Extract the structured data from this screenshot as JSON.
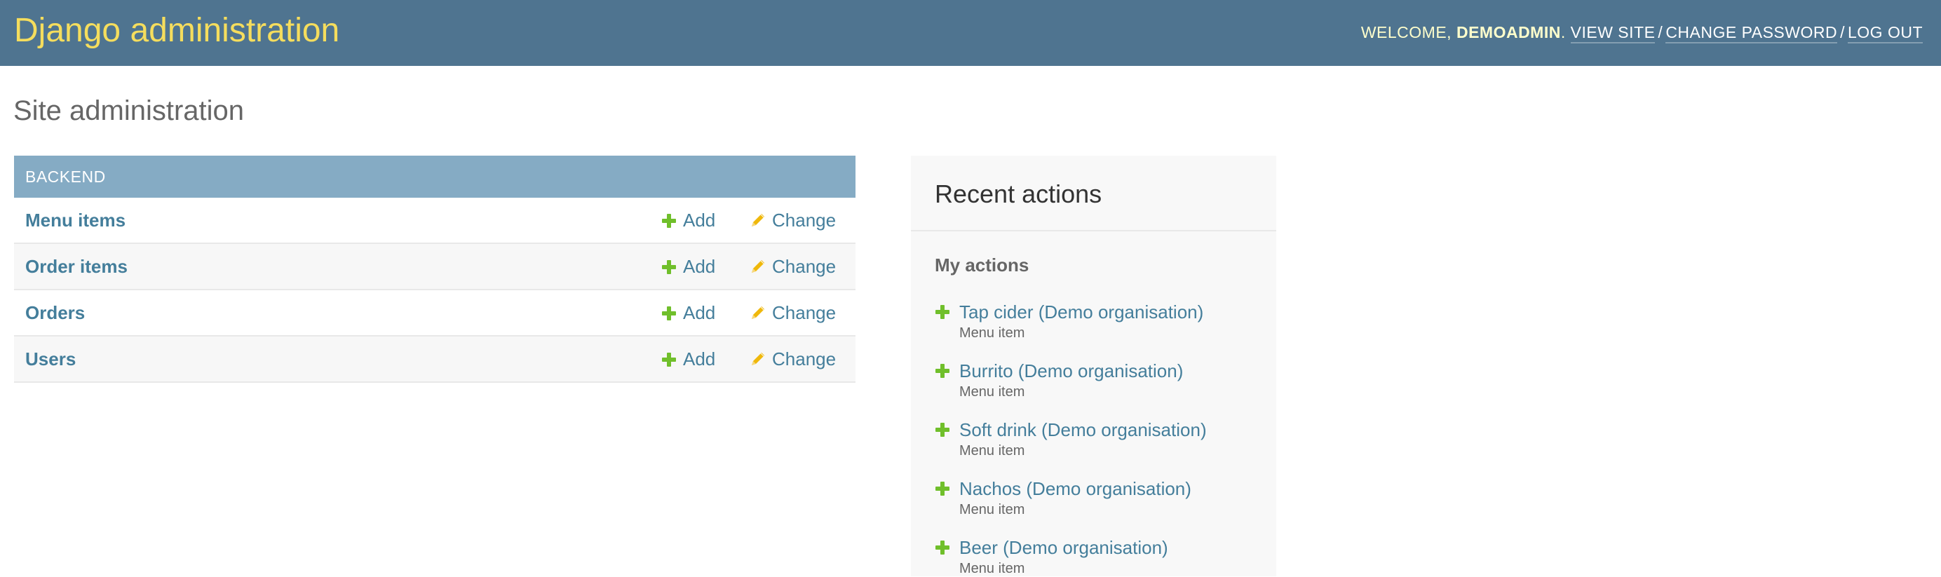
{
  "header": {
    "branding": "Django administration",
    "welcome_prefix": "Welcome, ",
    "username": "demoadmin",
    "welcome_suffix": ". ",
    "links": [
      {
        "label": "View site"
      },
      {
        "label": "Change password"
      },
      {
        "label": "Log out"
      }
    ],
    "separator": "/"
  },
  "page": {
    "title": "Site administration"
  },
  "module": {
    "caption": "Backend",
    "add_label": "Add",
    "change_label": "Change",
    "models": [
      {
        "name": "Menu items"
      },
      {
        "name": "Order items"
      },
      {
        "name": "Orders"
      },
      {
        "name": "Users"
      }
    ]
  },
  "recent_actions": {
    "title": "Recent actions",
    "subtitle": "My actions",
    "items": [
      {
        "icon": "add-icon",
        "title": "Tap cider (Demo organisation)",
        "type": "Menu item"
      },
      {
        "icon": "add-icon",
        "title": "Burrito (Demo organisation)",
        "type": "Menu item"
      },
      {
        "icon": "add-icon",
        "title": "Soft drink (Demo organisation)",
        "type": "Menu item"
      },
      {
        "icon": "add-icon",
        "title": "Nachos (Demo organisation)",
        "type": "Menu item"
      },
      {
        "icon": "add-icon",
        "title": "Beer (Demo organisation)",
        "type": "Menu item"
      }
    ]
  },
  "colors": {
    "header_bg": "#4f7490",
    "branding": "#f5dd5d",
    "caption_bg": "#85abc4",
    "link": "#447e9b",
    "add_icon": "#70bf2b",
    "change_icon": "#efb80b"
  }
}
